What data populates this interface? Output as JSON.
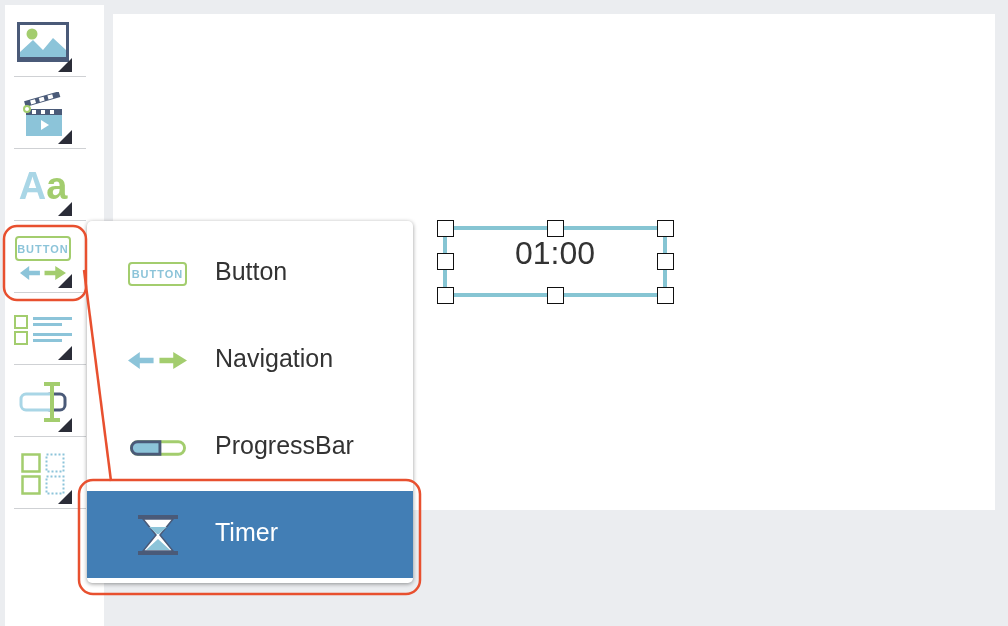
{
  "toolbar": {
    "items": [
      {
        "kind": "image",
        "highlighted": false
      },
      {
        "kind": "video",
        "highlighted": false
      },
      {
        "kind": "text",
        "icon_letters": [
          "A",
          "a"
        ],
        "highlighted": false
      },
      {
        "kind": "button",
        "icon_text": "BUTTON",
        "highlighted": true
      },
      {
        "kind": "list",
        "highlighted": false
      },
      {
        "kind": "input",
        "highlighted": false
      },
      {
        "kind": "layout",
        "highlighted": false
      }
    ]
  },
  "menu": {
    "items": [
      {
        "kind": "button",
        "icon_text": "BUTTON",
        "label": "Button",
        "selected": false,
        "highlighted": false
      },
      {
        "kind": "navigation",
        "label": "Navigation",
        "selected": false,
        "highlighted": false
      },
      {
        "kind": "progress",
        "label": "ProgressBar",
        "selected": false,
        "highlighted": false
      },
      {
        "kind": "timer",
        "label": "Timer",
        "selected": true,
        "highlighted": true
      }
    ]
  },
  "canvas": {
    "timer_widget": {
      "value": "01:00",
      "selected": true
    }
  }
}
